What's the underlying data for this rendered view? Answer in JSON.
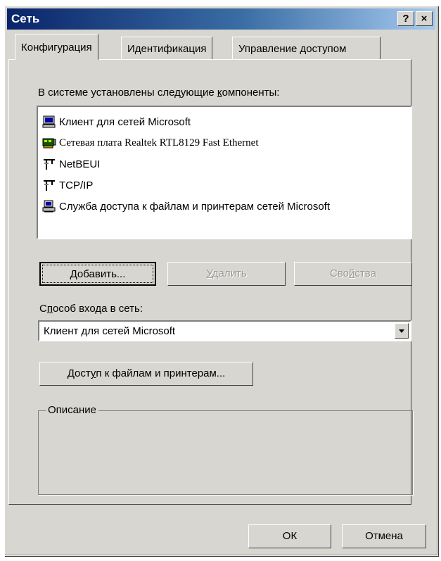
{
  "window": {
    "title": "Сеть",
    "help_glyph": "?",
    "close_glyph": "×"
  },
  "tabs": [
    {
      "label": "Конфигурация",
      "active": true
    },
    {
      "label": "Идентификация",
      "active": false
    },
    {
      "label": "Управление доступом",
      "active": false
    }
  ],
  "components": {
    "heading_pre": "В системе установлены следующие ",
    "heading_mnemonic": "к",
    "heading_post": "омпоненты:",
    "items": [
      {
        "label": "Клиент для сетей Microsoft",
        "icon": "network-client-icon"
      },
      {
        "label": "Сетевая плата Realtek RTL8129 Fast Ethernet",
        "icon": "network-card-icon"
      },
      {
        "label": "NetBEUI",
        "icon": "protocol-icon"
      },
      {
        "label": "TCP/IP",
        "icon": "protocol-icon"
      },
      {
        "label": "Служба доступа к файлам и принтерам сетей Microsoft",
        "icon": "file-printer-service-icon"
      }
    ]
  },
  "buttons": {
    "add_mnemonic": "Д",
    "add_rest": "обавить...",
    "remove_mnemonic": "У",
    "remove_rest": "далить",
    "properties_pre": "Сво",
    "properties_mnemonic": "й",
    "properties_post": "ства"
  },
  "logon": {
    "label_pre": "С",
    "label_mnemonic": "п",
    "label_post": "особ входа в сеть:",
    "value": "Клиент для сетей Microsoft"
  },
  "sharing": {
    "pre": "Дост",
    "mnemonic": "у",
    "post": "п к файлам и принтерам..."
  },
  "description": {
    "label": "Описание",
    "text": ""
  },
  "footer": {
    "ok": "ОК",
    "cancel": "Отмена"
  }
}
